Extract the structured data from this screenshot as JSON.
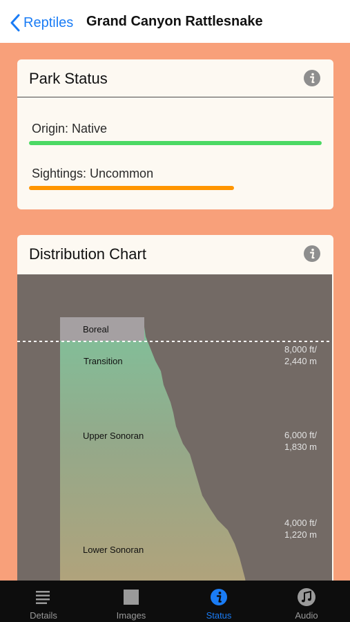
{
  "nav": {
    "back_label": "Reptiles",
    "title": "Grand Canyon Rattlesnake"
  },
  "park_status": {
    "title": "Park Status",
    "origin_label": "Origin: Native",
    "origin_color": "#4cd964",
    "origin_level": 1.0,
    "sightings_label": "Sightings: Uncommon",
    "sightings_color": "#ff9500",
    "sightings_level": 0.7
  },
  "distribution_chart": {
    "title": "Distribution Chart",
    "zones": [
      "Boreal",
      "Transition",
      "Upper Sonoran",
      "Lower Sonoran"
    ],
    "elevations": [
      {
        "ft": "8,000 ft/",
        "m": "2,440 m"
      },
      {
        "ft": "6,000 ft/",
        "m": "1,830 m"
      },
      {
        "ft": "4,000 ft/",
        "m": "1,220 m"
      }
    ]
  },
  "tabs": [
    {
      "label": "Details",
      "icon": "details-list-icon",
      "active": false
    },
    {
      "label": "Images",
      "icon": "images-square-icon",
      "active": false
    },
    {
      "label": "Status",
      "icon": "info-circle-icon",
      "active": true
    },
    {
      "label": "Audio",
      "icon": "music-note-icon",
      "active": false
    }
  ],
  "colors": {
    "accent": "#1a7cf5",
    "background": "#f8a07a",
    "card": "#fdf9f2",
    "chart_bg": "#736a65"
  }
}
